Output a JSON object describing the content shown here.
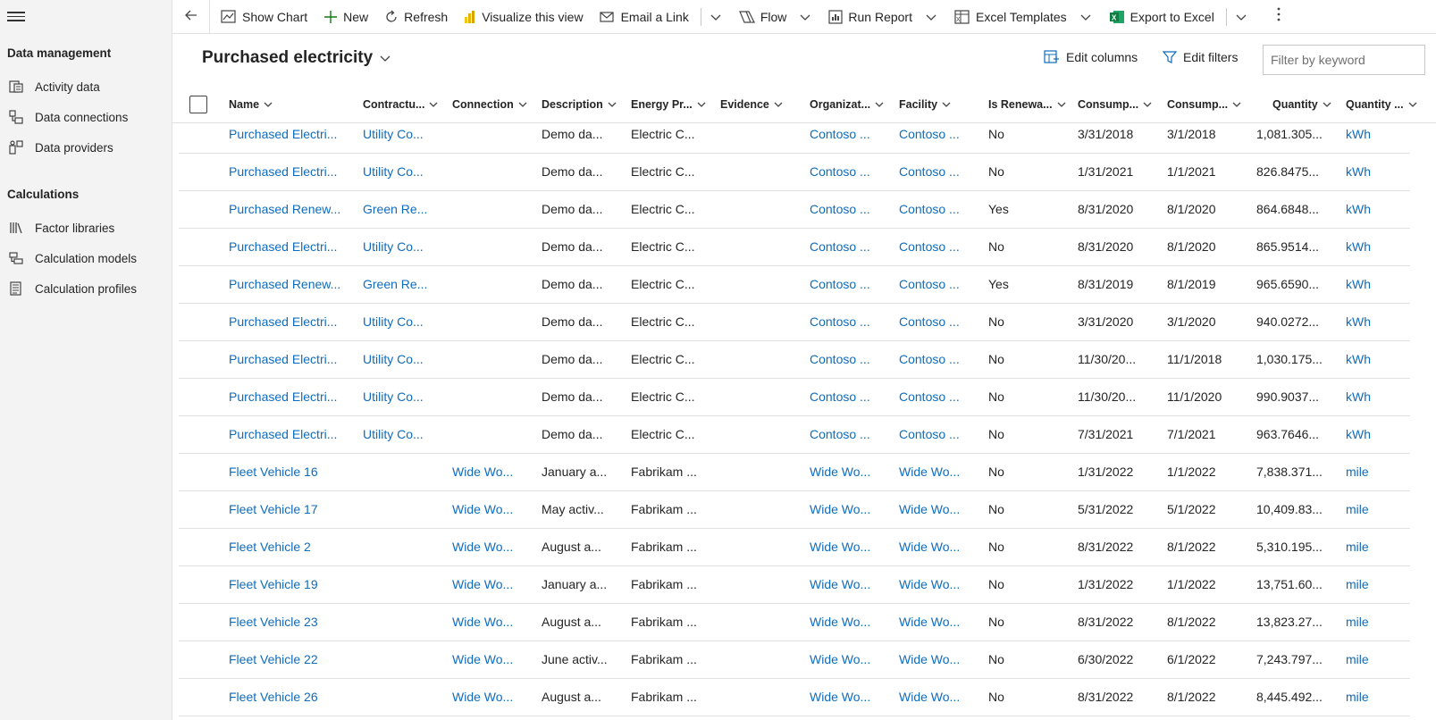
{
  "sidebar": {
    "group1": "Data management",
    "items1": [
      {
        "label": "Activity data",
        "icon": "activity-data-icon"
      },
      {
        "label": "Data connections",
        "icon": "data-connections-icon"
      },
      {
        "label": "Data providers",
        "icon": "data-providers-icon"
      }
    ],
    "group2": "Calculations",
    "items2": [
      {
        "label": "Factor libraries",
        "icon": "library-icon"
      },
      {
        "label": "Calculation models",
        "icon": "calculation-model-icon"
      },
      {
        "label": "Calculation profiles",
        "icon": "calculation-profile-icon"
      }
    ]
  },
  "toolbar": {
    "show_chart": "Show Chart",
    "new": "New",
    "refresh": "Refresh",
    "visualize": "Visualize this view",
    "email_link": "Email a Link",
    "flow": "Flow",
    "run_report": "Run Report",
    "excel_templates": "Excel Templates",
    "export_excel": "Export to Excel"
  },
  "view": {
    "title": "Purchased electricity",
    "edit_columns": "Edit columns",
    "edit_filters": "Edit filters",
    "filter_placeholder": "Filter by keyword"
  },
  "columns": [
    "Name",
    "Contractu...",
    "Connection",
    "Description",
    "Energy Pr...",
    "Evidence",
    "Organizat...",
    "Facility",
    "Is Renewa...",
    "Consump...",
    "Consump...",
    "Quantity",
    "Quantity ..."
  ],
  "rows": [
    [
      "Purchased Electri...",
      "Utility Co...",
      "",
      "Demo da...",
      "Electric C...",
      "",
      "Contoso ...",
      "Contoso ...",
      "No",
      "3/31/2018",
      "3/1/2018",
      "1,081.305...",
      "kWh"
    ],
    [
      "Purchased Electri...",
      "Utility Co...",
      "",
      "Demo da...",
      "Electric C...",
      "",
      "Contoso ...",
      "Contoso ...",
      "No",
      "1/31/2021",
      "1/1/2021",
      "826.8475...",
      "kWh"
    ],
    [
      "Purchased Renew...",
      "Green Re...",
      "",
      "Demo da...",
      "Electric C...",
      "",
      "Contoso ...",
      "Contoso ...",
      "Yes",
      "8/31/2020",
      "8/1/2020",
      "864.6848...",
      "kWh"
    ],
    [
      "Purchased Electri...",
      "Utility Co...",
      "",
      "Demo da...",
      "Electric C...",
      "",
      "Contoso ...",
      "Contoso ...",
      "No",
      "8/31/2020",
      "8/1/2020",
      "865.9514...",
      "kWh"
    ],
    [
      "Purchased Renew...",
      "Green Re...",
      "",
      "Demo da...",
      "Electric C...",
      "",
      "Contoso ...",
      "Contoso ...",
      "Yes",
      "8/31/2019",
      "8/1/2019",
      "965.6590...",
      "kWh"
    ],
    [
      "Purchased Electri...",
      "Utility Co...",
      "",
      "Demo da...",
      "Electric C...",
      "",
      "Contoso ...",
      "Contoso ...",
      "No",
      "3/31/2020",
      "3/1/2020",
      "940.0272...",
      "kWh"
    ],
    [
      "Purchased Electri...",
      "Utility Co...",
      "",
      "Demo da...",
      "Electric C...",
      "",
      "Contoso ...",
      "Contoso ...",
      "No",
      "11/30/20...",
      "11/1/2018",
      "1,030.175...",
      "kWh"
    ],
    [
      "Purchased Electri...",
      "Utility Co...",
      "",
      "Demo da...",
      "Electric C...",
      "",
      "Contoso ...",
      "Contoso ...",
      "No",
      "11/30/20...",
      "11/1/2020",
      "990.9037...",
      "kWh"
    ],
    [
      "Purchased Electri...",
      "Utility Co...",
      "",
      "Demo da...",
      "Electric C...",
      "",
      "Contoso ...",
      "Contoso ...",
      "No",
      "7/31/2021",
      "7/1/2021",
      "963.7646...",
      "kWh"
    ],
    [
      "Fleet Vehicle 16",
      "",
      "Wide Wo...",
      "January a...",
      "Fabrikam ...",
      "",
      "Wide Wo...",
      "Wide Wo...",
      "No",
      "1/31/2022",
      "1/1/2022",
      "7,838.371...",
      "mile"
    ],
    [
      "Fleet Vehicle 17",
      "",
      "Wide Wo...",
      "May activ...",
      "Fabrikam ...",
      "",
      "Wide Wo...",
      "Wide Wo...",
      "No",
      "5/31/2022",
      "5/1/2022",
      "10,409.83...",
      "mile"
    ],
    [
      "Fleet Vehicle 2",
      "",
      "Wide Wo...",
      "August a...",
      "Fabrikam ...",
      "",
      "Wide Wo...",
      "Wide Wo...",
      "No",
      "8/31/2022",
      "8/1/2022",
      "5,310.195...",
      "mile"
    ],
    [
      "Fleet Vehicle 19",
      "",
      "Wide Wo...",
      "January a...",
      "Fabrikam ...",
      "",
      "Wide Wo...",
      "Wide Wo...",
      "No",
      "1/31/2022",
      "1/1/2022",
      "13,751.60...",
      "mile"
    ],
    [
      "Fleet Vehicle 23",
      "",
      "Wide Wo...",
      "August a...",
      "Fabrikam ...",
      "",
      "Wide Wo...",
      "Wide Wo...",
      "No",
      "8/31/2022",
      "8/1/2022",
      "13,823.27...",
      "mile"
    ],
    [
      "Fleet Vehicle 22",
      "",
      "Wide Wo...",
      "June activ...",
      "Fabrikam ...",
      "",
      "Wide Wo...",
      "Wide Wo...",
      "No",
      "6/30/2022",
      "6/1/2022",
      "7,243.797...",
      "mile"
    ],
    [
      "Fleet Vehicle 26",
      "",
      "Wide Wo...",
      "August a...",
      "Fabrikam ...",
      "",
      "Wide Wo...",
      "Wide Wo...",
      "No",
      "8/31/2022",
      "8/1/2022",
      "8,445.492...",
      "mile"
    ]
  ],
  "colors": {
    "link": "#0f6cbd",
    "sidebar_bg": "#f3f3f3",
    "excel_green": "#107c41",
    "new_green": "#107c10",
    "pbi_yellow": "#f2c811"
  }
}
